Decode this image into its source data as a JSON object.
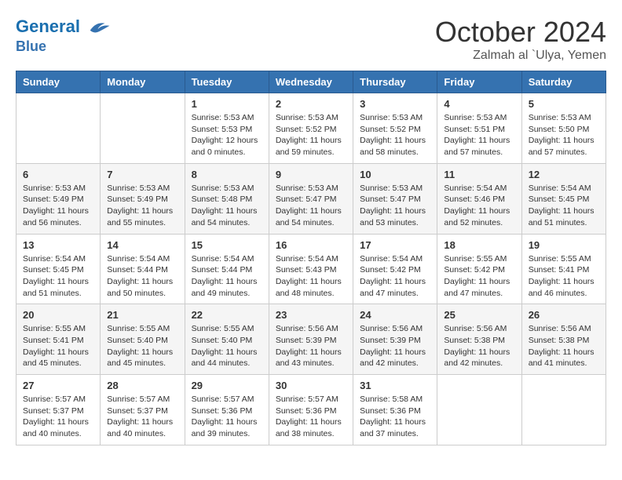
{
  "header": {
    "logo_line1": "General",
    "logo_line2": "Blue",
    "month": "October 2024",
    "location": "Zalmah al `Ulya, Yemen"
  },
  "weekdays": [
    "Sunday",
    "Monday",
    "Tuesday",
    "Wednesday",
    "Thursday",
    "Friday",
    "Saturday"
  ],
  "weeks": [
    [
      {
        "day": "",
        "info": ""
      },
      {
        "day": "",
        "info": ""
      },
      {
        "day": "1",
        "info": "Sunrise: 5:53 AM\nSunset: 5:53 PM\nDaylight: 12 hours and 0 minutes."
      },
      {
        "day": "2",
        "info": "Sunrise: 5:53 AM\nSunset: 5:52 PM\nDaylight: 11 hours and 59 minutes."
      },
      {
        "day": "3",
        "info": "Sunrise: 5:53 AM\nSunset: 5:52 PM\nDaylight: 11 hours and 58 minutes."
      },
      {
        "day": "4",
        "info": "Sunrise: 5:53 AM\nSunset: 5:51 PM\nDaylight: 11 hours and 57 minutes."
      },
      {
        "day": "5",
        "info": "Sunrise: 5:53 AM\nSunset: 5:50 PM\nDaylight: 11 hours and 57 minutes."
      }
    ],
    [
      {
        "day": "6",
        "info": "Sunrise: 5:53 AM\nSunset: 5:49 PM\nDaylight: 11 hours and 56 minutes."
      },
      {
        "day": "7",
        "info": "Sunrise: 5:53 AM\nSunset: 5:49 PM\nDaylight: 11 hours and 55 minutes."
      },
      {
        "day": "8",
        "info": "Sunrise: 5:53 AM\nSunset: 5:48 PM\nDaylight: 11 hours and 54 minutes."
      },
      {
        "day": "9",
        "info": "Sunrise: 5:53 AM\nSunset: 5:47 PM\nDaylight: 11 hours and 54 minutes."
      },
      {
        "day": "10",
        "info": "Sunrise: 5:53 AM\nSunset: 5:47 PM\nDaylight: 11 hours and 53 minutes."
      },
      {
        "day": "11",
        "info": "Sunrise: 5:54 AM\nSunset: 5:46 PM\nDaylight: 11 hours and 52 minutes."
      },
      {
        "day": "12",
        "info": "Sunrise: 5:54 AM\nSunset: 5:45 PM\nDaylight: 11 hours and 51 minutes."
      }
    ],
    [
      {
        "day": "13",
        "info": "Sunrise: 5:54 AM\nSunset: 5:45 PM\nDaylight: 11 hours and 51 minutes."
      },
      {
        "day": "14",
        "info": "Sunrise: 5:54 AM\nSunset: 5:44 PM\nDaylight: 11 hours and 50 minutes."
      },
      {
        "day": "15",
        "info": "Sunrise: 5:54 AM\nSunset: 5:44 PM\nDaylight: 11 hours and 49 minutes."
      },
      {
        "day": "16",
        "info": "Sunrise: 5:54 AM\nSunset: 5:43 PM\nDaylight: 11 hours and 48 minutes."
      },
      {
        "day": "17",
        "info": "Sunrise: 5:54 AM\nSunset: 5:42 PM\nDaylight: 11 hours and 47 minutes."
      },
      {
        "day": "18",
        "info": "Sunrise: 5:55 AM\nSunset: 5:42 PM\nDaylight: 11 hours and 47 minutes."
      },
      {
        "day": "19",
        "info": "Sunrise: 5:55 AM\nSunset: 5:41 PM\nDaylight: 11 hours and 46 minutes."
      }
    ],
    [
      {
        "day": "20",
        "info": "Sunrise: 5:55 AM\nSunset: 5:41 PM\nDaylight: 11 hours and 45 minutes."
      },
      {
        "day": "21",
        "info": "Sunrise: 5:55 AM\nSunset: 5:40 PM\nDaylight: 11 hours and 45 minutes."
      },
      {
        "day": "22",
        "info": "Sunrise: 5:55 AM\nSunset: 5:40 PM\nDaylight: 11 hours and 44 minutes."
      },
      {
        "day": "23",
        "info": "Sunrise: 5:56 AM\nSunset: 5:39 PM\nDaylight: 11 hours and 43 minutes."
      },
      {
        "day": "24",
        "info": "Sunrise: 5:56 AM\nSunset: 5:39 PM\nDaylight: 11 hours and 42 minutes."
      },
      {
        "day": "25",
        "info": "Sunrise: 5:56 AM\nSunset: 5:38 PM\nDaylight: 11 hours and 42 minutes."
      },
      {
        "day": "26",
        "info": "Sunrise: 5:56 AM\nSunset: 5:38 PM\nDaylight: 11 hours and 41 minutes."
      }
    ],
    [
      {
        "day": "27",
        "info": "Sunrise: 5:57 AM\nSunset: 5:37 PM\nDaylight: 11 hours and 40 minutes."
      },
      {
        "day": "28",
        "info": "Sunrise: 5:57 AM\nSunset: 5:37 PM\nDaylight: 11 hours and 40 minutes."
      },
      {
        "day": "29",
        "info": "Sunrise: 5:57 AM\nSunset: 5:36 PM\nDaylight: 11 hours and 39 minutes."
      },
      {
        "day": "30",
        "info": "Sunrise: 5:57 AM\nSunset: 5:36 PM\nDaylight: 11 hours and 38 minutes."
      },
      {
        "day": "31",
        "info": "Sunrise: 5:58 AM\nSunset: 5:36 PM\nDaylight: 11 hours and 37 minutes."
      },
      {
        "day": "",
        "info": ""
      },
      {
        "day": "",
        "info": ""
      }
    ]
  ]
}
